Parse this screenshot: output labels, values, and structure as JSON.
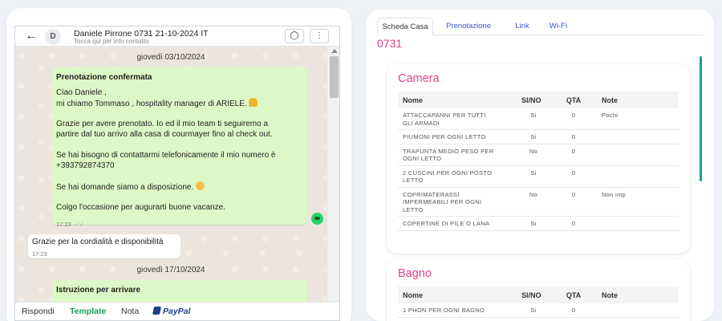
{
  "chat": {
    "header": {
      "back_icon": "arrow-left-icon",
      "avatar_initial": "D",
      "contact_name": "Daniele Pirrone 0731 21-10-2024 IT",
      "contact_sub": "Tocca qui per info contatto",
      "tag_icon": "tag-icon",
      "more_icon": "more-vertical-icon"
    },
    "days": [
      "giovedì 03/10/2024",
      "giovedì 17/10/2024"
    ],
    "message1": {
      "title": "Prenotazione confermata",
      "line1": "Ciao Daniele ,",
      "line2": "mi chiamo Tommaso , hospitality manager di ARIELE.",
      "line3": "Grazie per avere prenotato. Io ed il mio team ti seguiremo a",
      "line4": "partire dal tuo arrivo alla casa di courmayer fino al check out.",
      "line5": "Se hai bisogno di contattarmi telefonicamente il mio numero è",
      "line6": "+393792874370",
      "line7": "Se hai domande siamo a disposizione.",
      "line8": "Colgo l'occasione per augurarti buone vacanze.",
      "time": "17:23"
    },
    "message2": {
      "text": "Grazie per la cordialità e disponibilità",
      "time": "17:23"
    },
    "message3": {
      "title": "Istruzione per arrivare"
    },
    "tabs": {
      "rispondi": "Rispondi",
      "template": "Template",
      "nota": "Nota",
      "paypal": "PayPal"
    }
  },
  "panel": {
    "tabs": [
      "Scheda Casa",
      "Prenotazione",
      "Link",
      "Wi-Fi"
    ],
    "active_tab": "Scheda Casa",
    "house_code": "0731",
    "columns": [
      "Nome",
      "SI/NO",
      "QTA",
      "Note"
    ],
    "camera": {
      "title": "Camera",
      "rows": [
        {
          "nome1": "ATTACCAPANNI PER TUTTI",
          "nome2": "GLI ARMADI",
          "sino": "Si",
          "qta": "0",
          "note": "Pochi"
        },
        {
          "nome1": "PIUMONI PER OGNI LETTO",
          "nome2": "",
          "sino": "Si",
          "qta": "0",
          "note": ""
        },
        {
          "nome1": "TRAPUNTA MEDIO PESO PER",
          "nome2": "OGNI LETTO",
          "sino": "No",
          "qta": "0",
          "note": ""
        },
        {
          "nome1": "2 CUSCINI PER OGNI POSTO",
          "nome2": "LETTO",
          "sino": "Si",
          "qta": "0",
          "note": ""
        },
        {
          "nome1": "COPRIMATERASSI",
          "nome2": "IMPERMEABILI PER OGNI",
          "nome3": "LETTO",
          "sino": "No",
          "qta": "0",
          "note": "Non imp"
        },
        {
          "nome1": "COPERTINE DI PILE O LANA",
          "nome2": "",
          "sino": "Si",
          "qta": "0",
          "note": ""
        }
      ]
    },
    "bagno": {
      "title": "Bagno",
      "rows": [
        {
          "nome1": "1 PHON PER OGNI BAGNO",
          "sino": "Si",
          "qta": "0",
          "note": ""
        }
      ]
    }
  }
}
